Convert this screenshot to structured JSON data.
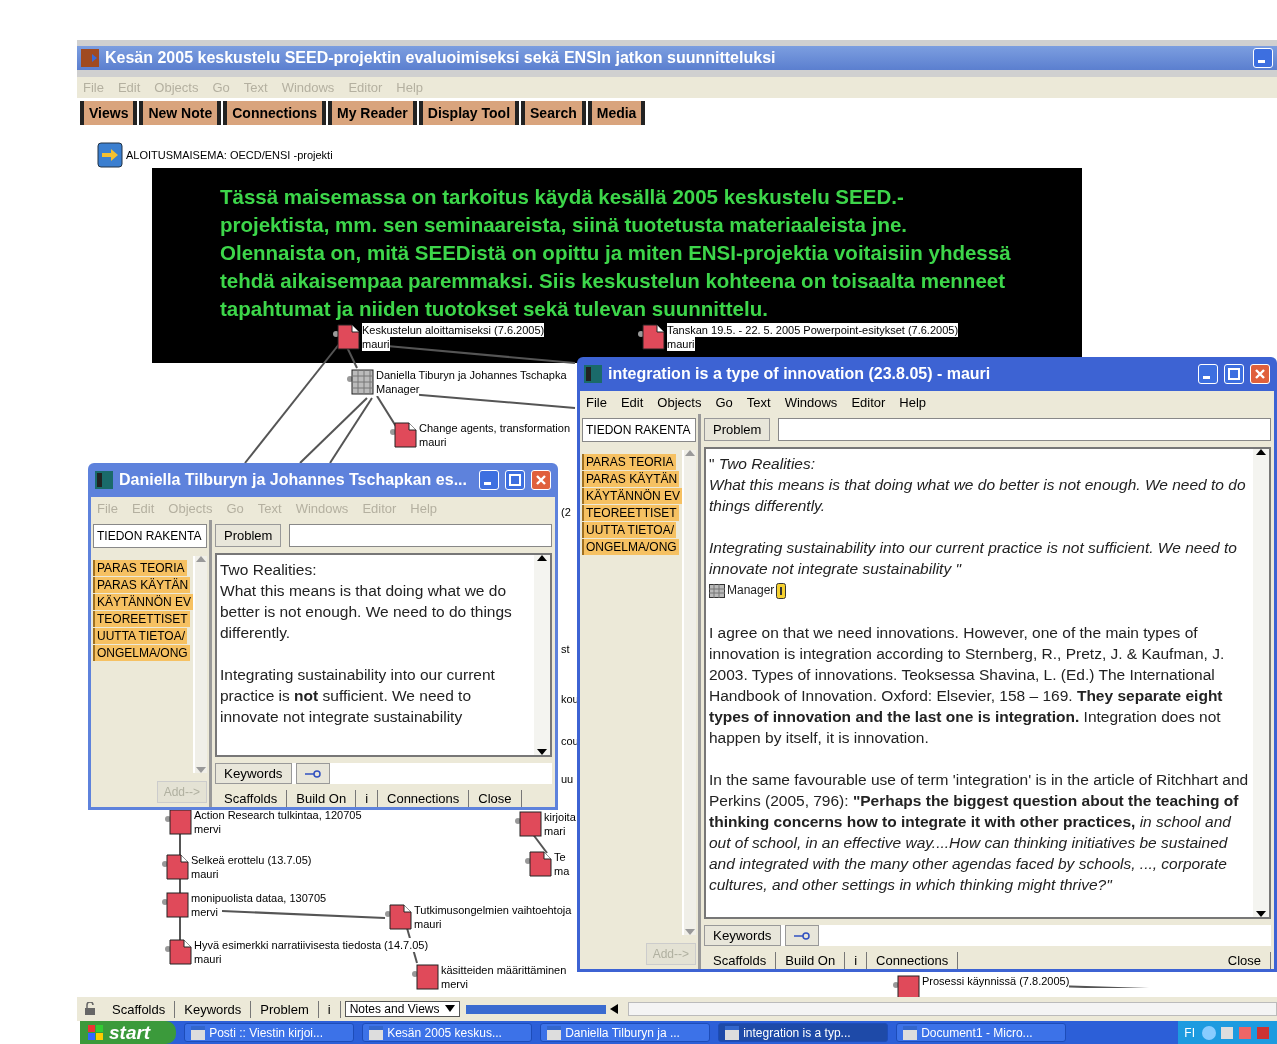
{
  "main_window": {
    "title": "Kesän 2005 keskustelu SEED-projektin evaluoimiseksi sekä ENSIn jatkon suunnitteluksi",
    "menu": [
      "File",
      "Edit",
      "Objects",
      "Go",
      "Text",
      "Windows",
      "Editor",
      "Help"
    ],
    "menu_disabled": true,
    "toolbar": [
      "Views",
      "New Note",
      "Connections",
      "My Reader",
      "Display Tool",
      "Search",
      "Media"
    ]
  },
  "canvas": {
    "start_view": {
      "label": "ALOITUSMAISEMA: OECD/ENSI -projekti"
    },
    "banner": {
      "text": "Tässä maisemassa on tarkoitus käydä  kesällä 2005 keskustelu SEED.-projektista, mm. sen seminaareista, siinä tuotetusta materiaaleista jne. Olennaista on, mitä SEEDistä on opittu ja miten ENSI-projektia voitaisiin yhdessä tehdä aikaisempaa paremmaksi. Siis keskustelun kohteena on toisaalta menneet tapahtumat ja niiden tuotokset sekä tulevan suunnittelu."
    },
    "notes": [
      {
        "kind": "folded",
        "title": "Keskustelun aloittamiseksi (7.6.2005)",
        "author": "mauri"
      },
      {
        "kind": "folded",
        "title": "Tanskan 19.5. - 22. 5. 2005 Powerpoint-esitykset (7.6.2005)",
        "author": "mauri"
      },
      {
        "kind": "hatched",
        "title": "Daniella Tiburyn ja Johannes Tschapka",
        "author": "Manager"
      },
      {
        "kind": "folded",
        "title": "Change agents, transformation",
        "author": "mauri"
      },
      {
        "kind": "plain",
        "title": "Action Research tulkintaa, 120705",
        "author": "mervi"
      },
      {
        "kind": "folded",
        "title": "Selkeä erottelu (13.7.05)",
        "author": "mauri"
      },
      {
        "kind": "plain",
        "title": "monipuolista dataa, 130705",
        "author": "mervi"
      },
      {
        "kind": "folded",
        "title": "Hyvä esimerkki narratiivisesta tiedosta (14.7.05)",
        "author": "mauri"
      },
      {
        "kind": "folded",
        "title": "Tutkimusongelmien vaihtoehtoja",
        "author": "mauri"
      },
      {
        "kind": "plain",
        "title": "käsitteiden määrittäminen",
        "author": "mervi"
      },
      {
        "kind": "plain",
        "title": "kirjoita",
        "author": "mari"
      },
      {
        "kind": "folded",
        "title": "Te",
        "author": "ma"
      },
      {
        "kind": "plain",
        "title": "Prosessi käynnissä (7.8.2005)"
      }
    ],
    "fragments": [
      "(2",
      "st",
      "kou",
      "cou",
      "uu"
    ]
  },
  "windows": [
    {
      "title": "Daniella Tilburyn ja Johannes Tschapkan es...",
      "active": false,
      "menu": [
        "File",
        "Edit",
        "Objects",
        "Go",
        "Text",
        "Windows",
        "Editor",
        "Help"
      ],
      "menu_disabled": true,
      "scaffold_field": "TIEDON RAKENTA",
      "problem_button": "Problem",
      "tags": [
        "PARAS TEORIA",
        "PARAS KÄYTÄN",
        "KÄYTÄNNÖN EV",
        "TEOREETTISET",
        "UUTTA TIETOA/",
        "ONGELMA/ONG"
      ],
      "add_button": "Add-->",
      "body": [
        {
          "paragraphs": [
            "Two Realities:",
            "What this means is that doing what we do better is not enough. We need to do things differently."
          ]
        },
        {
          "paragraphs": [
            "Integrating sustainability into our current practice is **not** sufficient. We need to innovate not integrate sustainability"
          ]
        }
      ],
      "keywords_button": "Keywords",
      "tabs": [
        "Scaffolds",
        "Build On",
        "i",
        "Connections",
        "Close"
      ]
    },
    {
      "title": "integration is a type of innovation (23.8.05) - mauri",
      "active": true,
      "menu": [
        "File",
        "Edit",
        "Objects",
        "Go",
        "Text",
        "Windows",
        "Editor",
        "Help"
      ],
      "menu_disabled": false,
      "scaffold_field": "TIEDON RAKENTA",
      "problem_button": "Problem",
      "tags": [
        "PARAS TEORIA",
        "PARAS KÄYTÄN",
        "KÄYTÄNNÖN EV",
        "TEOREETTISET",
        "UUTTA TIETOA/",
        "ONGELMA/ONG"
      ],
      "add_button": "Add-->",
      "body": [
        {
          "paragraphs": [
            "\"    *Two Realities:*",
            "*What this means is that doing what we do better is not enough. We need to do things differently.*"
          ]
        },
        {
          "paragraphs": [
            "*Integrating sustainability into our current practice is not sufficient. We need to innovate not integrate sustainability \"*"
          ],
          "attachment": "Manager"
        },
        {
          "paragraphs": [
            "I agree on that we need innovations. However, one of the main  types of innovation is integration according to Sternberg, R., Pretz, J. & Kaufman, J. 2003. Types of innovations.  Teoksessa Shavina, L. (Ed.) The International Handbook of Innovation. Oxford: Elsevier, 158 – 169. **They separate eight types of innovation and the last one is integration.** Integration does not happen by itself, it is innovation."
          ]
        },
        {
          "paragraphs": [
            "In the same favourable use of  term 'integration' is in the article of Ritchhart and Perkins (2005, 796):  **\"Perhaps the biggest question about the teaching of thinking concerns how to integrate it with other practices,** *in school and out of school, in an effective way....How can thinking initiatives be sustained and integrated with the many other agendas faced by schools, ..., corporate cultures, and other settings in which thinking might thrive?\"*"
          ]
        }
      ],
      "keywords_button": "Keywords",
      "tabs": [
        "Scaffolds",
        "Build On",
        "i",
        "Connections",
        "Close"
      ]
    }
  ],
  "status_bar": {
    "tabs": [
      "Scaffolds",
      "Keywords",
      "Problem",
      "i"
    ],
    "view_select": {
      "value": "Notes and Views"
    }
  },
  "taskbar": {
    "start": "start",
    "tasks": [
      {
        "label": "Posti :: Viestin kirjoi...",
        "selected": false
      },
      {
        "label": "Kesän 2005 keskus...",
        "selected": false
      },
      {
        "label": "Daniella Tilburyn ja ...",
        "selected": false
      },
      {
        "label": "integration is a typ...",
        "selected": true
      },
      {
        "label": "Document1 - Micro...",
        "selected": false
      }
    ],
    "language": "FI"
  }
}
